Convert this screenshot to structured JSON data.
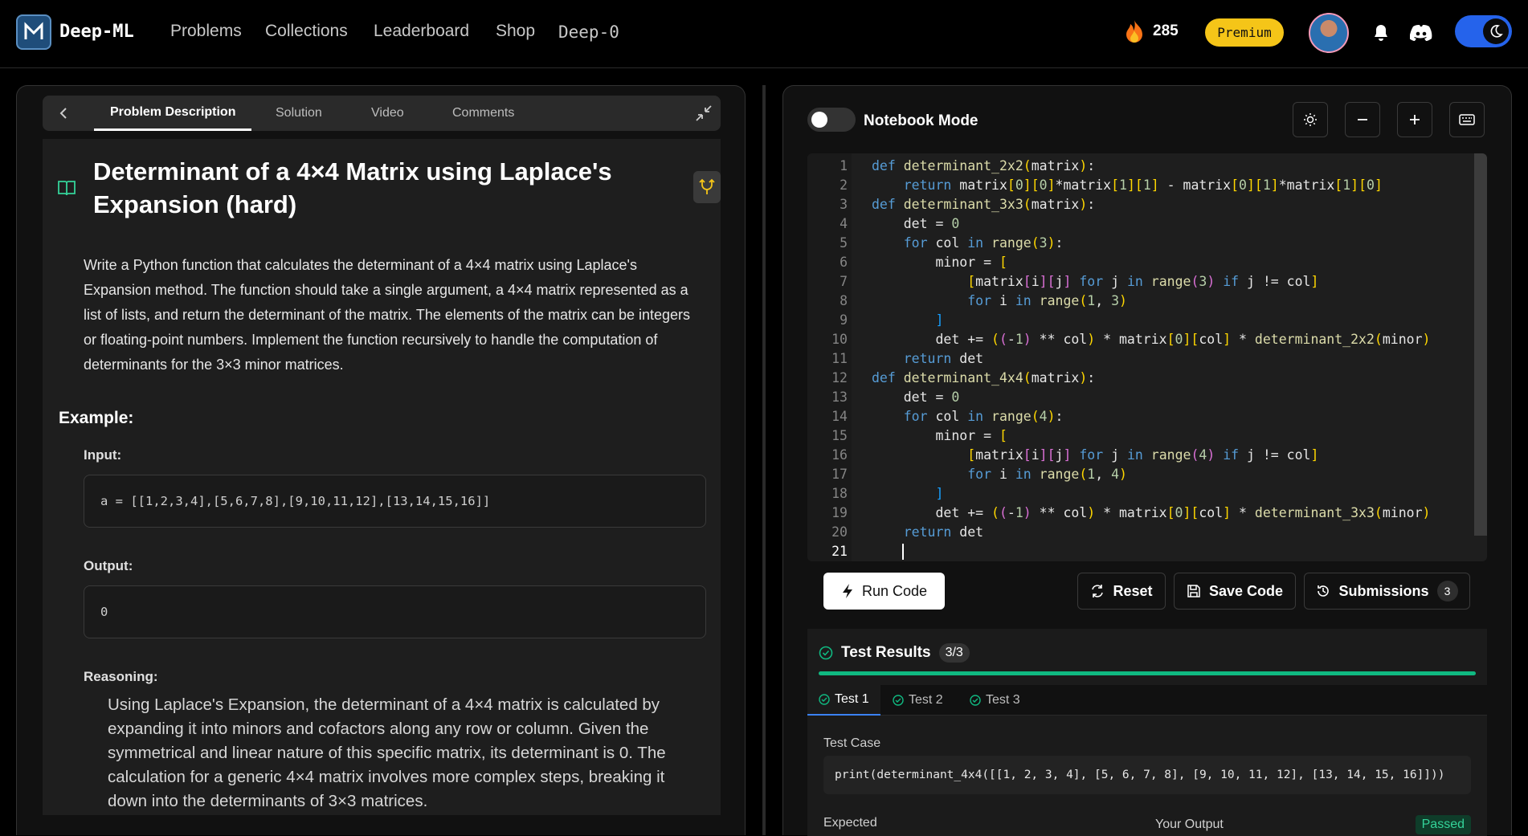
{
  "nav": {
    "brand": "Deep-ML",
    "links": [
      "Problems",
      "Collections",
      "Leaderboard",
      "Shop"
    ],
    "deep0": "Deep-0",
    "streak": "285",
    "premium": "Premium"
  },
  "problem": {
    "tabs": [
      "Problem Description",
      "Solution",
      "Video",
      "Comments"
    ],
    "title": "Determinant of a 4×4 Matrix using Laplace's Expansion (hard)",
    "description": "Write a Python function that calculates the determinant of a 4×4 matrix using Laplace's Expansion method. The function should take a single argument, a 4×4 matrix represented as a list of lists, and return the determinant of the matrix. The elements of the matrix can be integers or floating-point numbers. Implement the function recursively to handle the computation of determinants for the 3×3 minor matrices.",
    "example_heading": "Example:",
    "input_label": "Input:",
    "input_value": "a = [[1,2,3,4],[5,6,7,8],[9,10,11,12],[13,14,15,16]]",
    "output_label": "Output:",
    "output_value": "0",
    "reasoning_label": "Reasoning:",
    "reasoning": "Using Laplace's Expansion, the determinant of a 4×4 matrix is calculated by expanding it into minors and cofactors along any row or column. Given the symmetrical and linear nature of this specific matrix, its determinant is 0. The calculation for a generic 4×4 matrix involves more complex steps, breaking it down into the determinants of 3×3 matrices."
  },
  "editor": {
    "notebook_label": "Notebook Mode",
    "line_numbers": [
      "1",
      "2",
      "3",
      "4",
      "5",
      "6",
      "7",
      "8",
      "9",
      "10",
      "11",
      "12",
      "13",
      "14",
      "15",
      "16",
      "17",
      "18",
      "19",
      "20",
      "21"
    ],
    "lines": [
      "def determinant_2x2(matrix):",
      "    return matrix[0][0]*matrix[1][1] - matrix[0][1]*matrix[1][0]",
      "def determinant_3x3(matrix):",
      "    det = 0",
      "    for col in range(3):",
      "        minor = [",
      "            [matrix[i][j] for j in range(3) if j != col]",
      "            for i in range(1, 3)",
      "        ]",
      "        det += ((-1) ** col) * matrix[0][col] * determinant_2x2(minor)",
      "    return det",
      "def determinant_4x4(matrix):",
      "    det = 0",
      "    for col in range(4):",
      "        minor = [",
      "            [matrix[i][j] for j in range(4) if j != col]",
      "            for i in range(1, 4)",
      "        ]",
      "        det += ((-1) ** col) * matrix[0][col] * determinant_3x3(minor)",
      "    return det",
      ""
    ]
  },
  "actions": {
    "run": "Run Code",
    "reset": "Reset",
    "save": "Save Code",
    "submissions": "Submissions",
    "submissions_count": "3"
  },
  "results": {
    "title": "Test Results",
    "score": "3/3",
    "progress": 1.0,
    "tests": [
      "Test 1",
      "Test 2",
      "Test 3"
    ],
    "test_case_label": "Test Case",
    "test_case_code": "print(determinant_4x4([[1, 2, 3, 4], [5, 6, 7, 8], [9, 10, 11, 12], [13, 14, 15, 16]]))",
    "expected_label": "Expected",
    "your_output_label": "Your Output",
    "status": "Passed"
  },
  "colors": {
    "accent": "#10b981",
    "premium": "#f5c518",
    "toggle": "#2563eb"
  }
}
